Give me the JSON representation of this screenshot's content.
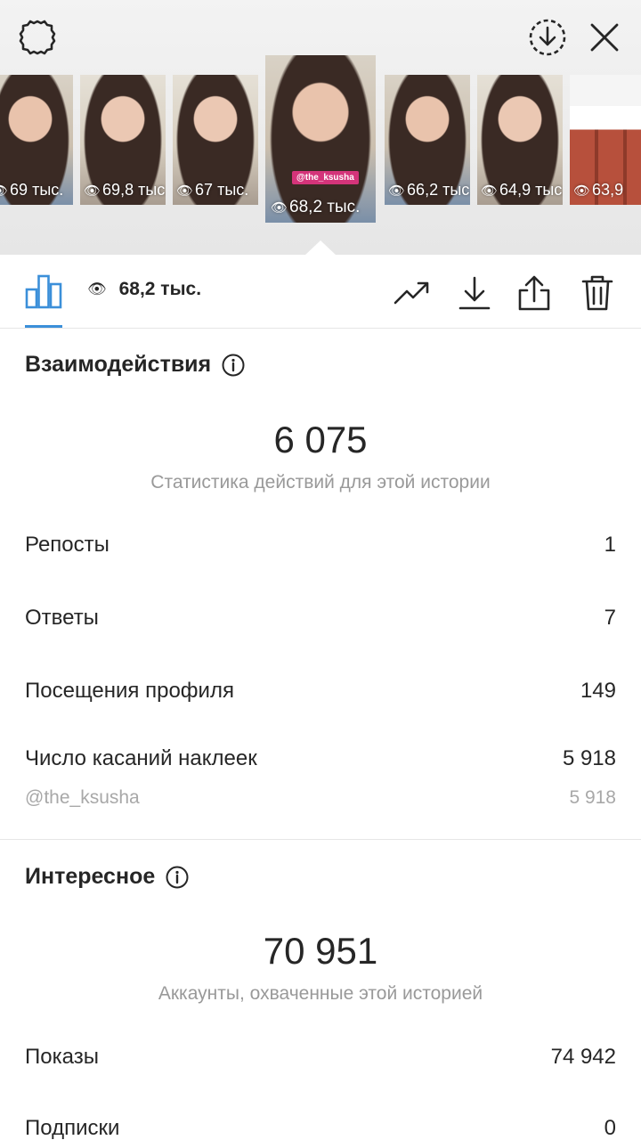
{
  "header": {
    "settings_icon": "gear-icon",
    "download_icon": "download-circle-icon",
    "close_icon": "close-icon"
  },
  "stories": [
    {
      "views": "69 тыс."
    },
    {
      "views": "69,8 тыс."
    },
    {
      "views": "67 тыс."
    },
    {
      "views": "68,2 тыс.",
      "active": true,
      "sticker": "@the_ksusha"
    },
    {
      "views": "66,2 тыс."
    },
    {
      "views": "64,9 тыс."
    },
    {
      "views": "63,9"
    }
  ],
  "toolbar": {
    "reach_value": "68,2 тыс.",
    "accent_color": "#3b8fd9"
  },
  "interactions": {
    "title": "Взаимодействия",
    "total": "6 075",
    "caption": "Статистика действий для этой истории",
    "rows": [
      {
        "label": "Репосты",
        "value": "1"
      },
      {
        "label": "Ответы",
        "value": "7"
      },
      {
        "label": "Посещения профиля",
        "value": "149"
      },
      {
        "label": "Число касаний наклеек",
        "value": "5 918"
      }
    ],
    "sticker_row": {
      "label": "@the_ksusha",
      "value": "5 918"
    }
  },
  "discovery": {
    "title": "Интересное",
    "total": "70 951",
    "caption": "Аккаунты, охваченные этой историей",
    "rows": [
      {
        "label": "Показы",
        "value": "74 942"
      },
      {
        "label": "Подписки",
        "value": "0"
      }
    ]
  }
}
